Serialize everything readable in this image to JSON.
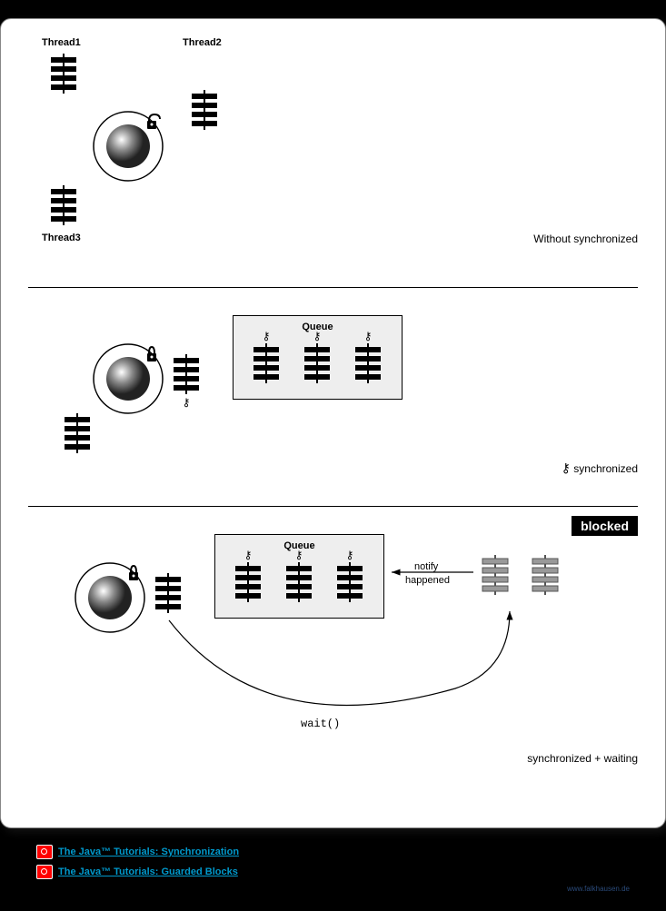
{
  "panel1": {
    "thread1": "Thread1",
    "thread2": "Thread2",
    "thread3": "Thread3",
    "caption": "Without synchronized"
  },
  "panel2": {
    "queue": "Queue",
    "caption": "synchronized",
    "key": "⚷"
  },
  "panel3": {
    "queue": "Queue",
    "blocked": "blocked",
    "notify1": "notify",
    "notify2": "happened",
    "wait": "wait()",
    "caption": "synchronized + waiting"
  },
  "links": {
    "l1": "The Java™ Tutorials: Synchronization",
    "l2": "The Java™ Tutorials: Guarded Blocks"
  },
  "credit": "www.falkhausen.de"
}
